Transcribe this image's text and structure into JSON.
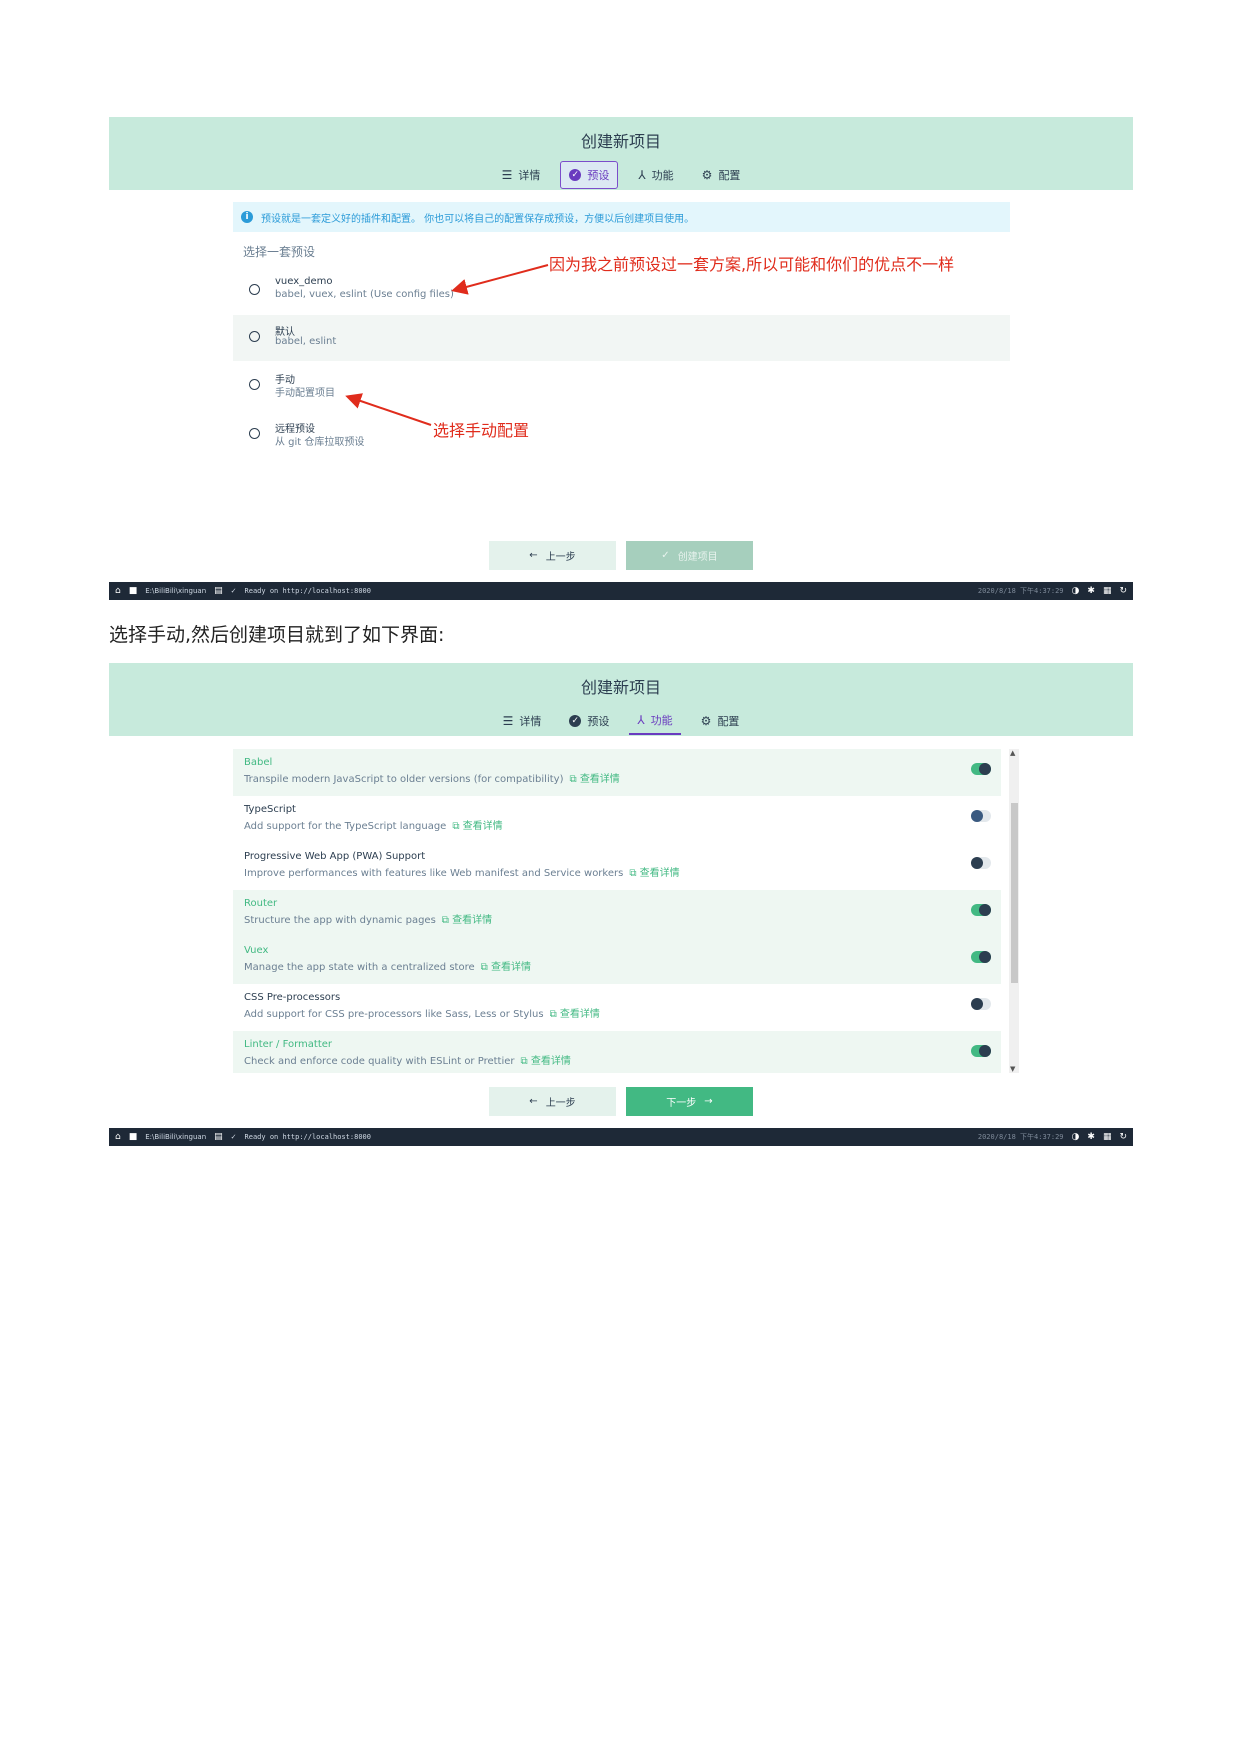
{
  "screen1": {
    "title": "创建新项目",
    "tabs": [
      {
        "label": "详情"
      },
      {
        "label": "预设"
      },
      {
        "label": "功能"
      },
      {
        "label": "配置"
      }
    ],
    "info": "预设就是一套定义好的插件和配置。 你也可以将自己的配置保存成预设，方便以后创建项目使用。",
    "section_title": "选择一套预设",
    "presets": [
      {
        "name": "vuex_demo",
        "desc": "babel, vuex, eslint (Use config files)"
      },
      {
        "name": "默认",
        "desc": "babel, eslint"
      },
      {
        "name": "手动",
        "desc": "手动配置项目"
      },
      {
        "name": "远程预设",
        "desc": "从 git 仓库拉取预设"
      }
    ],
    "annotation1": "因为我之前预设过一套方案,所以可能和你们的优点不一样",
    "annotation2": "选择手动配置",
    "btn_prev": "上一步",
    "btn_create": "创建项目",
    "statusbar": {
      "path": "E:\\BiliBili\\xinguan",
      "ready": "Ready on http://localhost:8000",
      "time": "2020/8/18 下午4:37:29"
    },
    "colors": {
      "header_bg": "#c7eadc",
      "accent": "#42b983",
      "active_tab": "#6a3bbf",
      "annotation": "#e02c1c"
    }
  },
  "caption": "选择手动,然后创建项目就到了如下界面:",
  "screen2": {
    "title": "创建新项目",
    "tabs": [
      {
        "label": "详情"
      },
      {
        "label": "预设"
      },
      {
        "label": "功能"
      },
      {
        "label": "配置"
      }
    ],
    "features": [
      {
        "name": "Babel",
        "desc": "Transpile modern JavaScript to older versions (for compatibility)",
        "more": "查看详情",
        "enabled": true
      },
      {
        "name": "TypeScript",
        "desc": "Add support for the TypeScript language",
        "more": "查看详情",
        "enabled": false
      },
      {
        "name": "Progressive Web App (PWA) Support",
        "desc": "Improve performances with features like Web manifest and Service workers",
        "more": "查看详情",
        "enabled": false
      },
      {
        "name": "Router",
        "desc": "Structure the app with dynamic pages",
        "more": "查看详情",
        "enabled": true
      },
      {
        "name": "Vuex",
        "desc": "Manage the app state with a centralized store",
        "more": "查看详情",
        "enabled": true
      },
      {
        "name": "CSS Pre-processors",
        "desc": "Add support for CSS pre-processors like Sass, Less or Stylus",
        "more": "查看详情",
        "enabled": false
      },
      {
        "name": "Linter / Formatter",
        "desc": "Check and enforce code quality with ESLint or Prettier",
        "more": "查看详情",
        "enabled": true
      }
    ],
    "btn_prev": "上一步",
    "btn_next": "下一步",
    "statusbar": {
      "path": "E:\\BiliBili\\xinguan",
      "ready": "Ready on http://localhost:8000",
      "time": "2020/8/18 下午4:37:29"
    }
  }
}
